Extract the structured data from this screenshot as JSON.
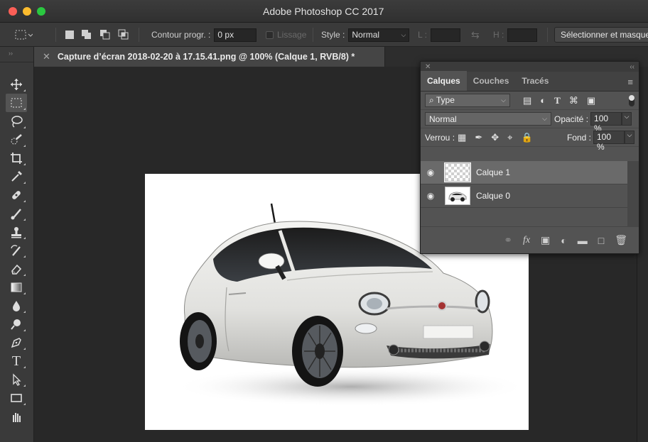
{
  "app": {
    "title": "Adobe Photoshop CC 2017"
  },
  "options_bar": {
    "feather_label": "Contour progr. :",
    "feather_value": "0 px",
    "antialias_label": "Lissage",
    "style_label": "Style :",
    "style_value": "Normal",
    "width_label": "L :",
    "width_value": "",
    "height_label": "H :",
    "height_value": "",
    "select_mask_label": "Sélectionner et masquer"
  },
  "document": {
    "tab_title": "Capture d’écran 2018-02-20 à 17.15.41.png @ 100% (Calque 1, RVB/8) *"
  },
  "layers_panel": {
    "tabs": [
      {
        "label": "Calques"
      },
      {
        "label": "Couches"
      },
      {
        "label": "Tracés"
      }
    ],
    "filter_value": "Type",
    "blend_mode": "Normal",
    "opacity_label": "Opacité :",
    "opacity_value": "100 %",
    "lock_label": "Verrou :",
    "fill_label": "Fond :",
    "fill_value": "100 %",
    "layers": [
      {
        "name": "Calque 1",
        "selected": true,
        "visible": true,
        "thumbnail": "transparent"
      },
      {
        "name": "Calque 0",
        "selected": false,
        "visible": true,
        "thumbnail": "car"
      }
    ]
  },
  "colors": {
    "chrome_bg": "#3a3a3a",
    "canvas_bg": "#282828",
    "panel_bg": "#535353",
    "selected_layer": "#6a6a6a"
  },
  "icons": {
    "toolbar": [
      "move-icon",
      "marquee-icon",
      "lasso-icon",
      "quick-selection-icon",
      "crop-icon",
      "eyedropper-icon",
      "healing-brush-icon",
      "brush-icon",
      "clone-stamp-icon",
      "history-brush-icon",
      "eraser-icon",
      "gradient-icon",
      "blur-icon",
      "dodge-icon",
      "pen-icon",
      "type-icon",
      "path-selection-icon",
      "rectangle-icon"
    ]
  }
}
